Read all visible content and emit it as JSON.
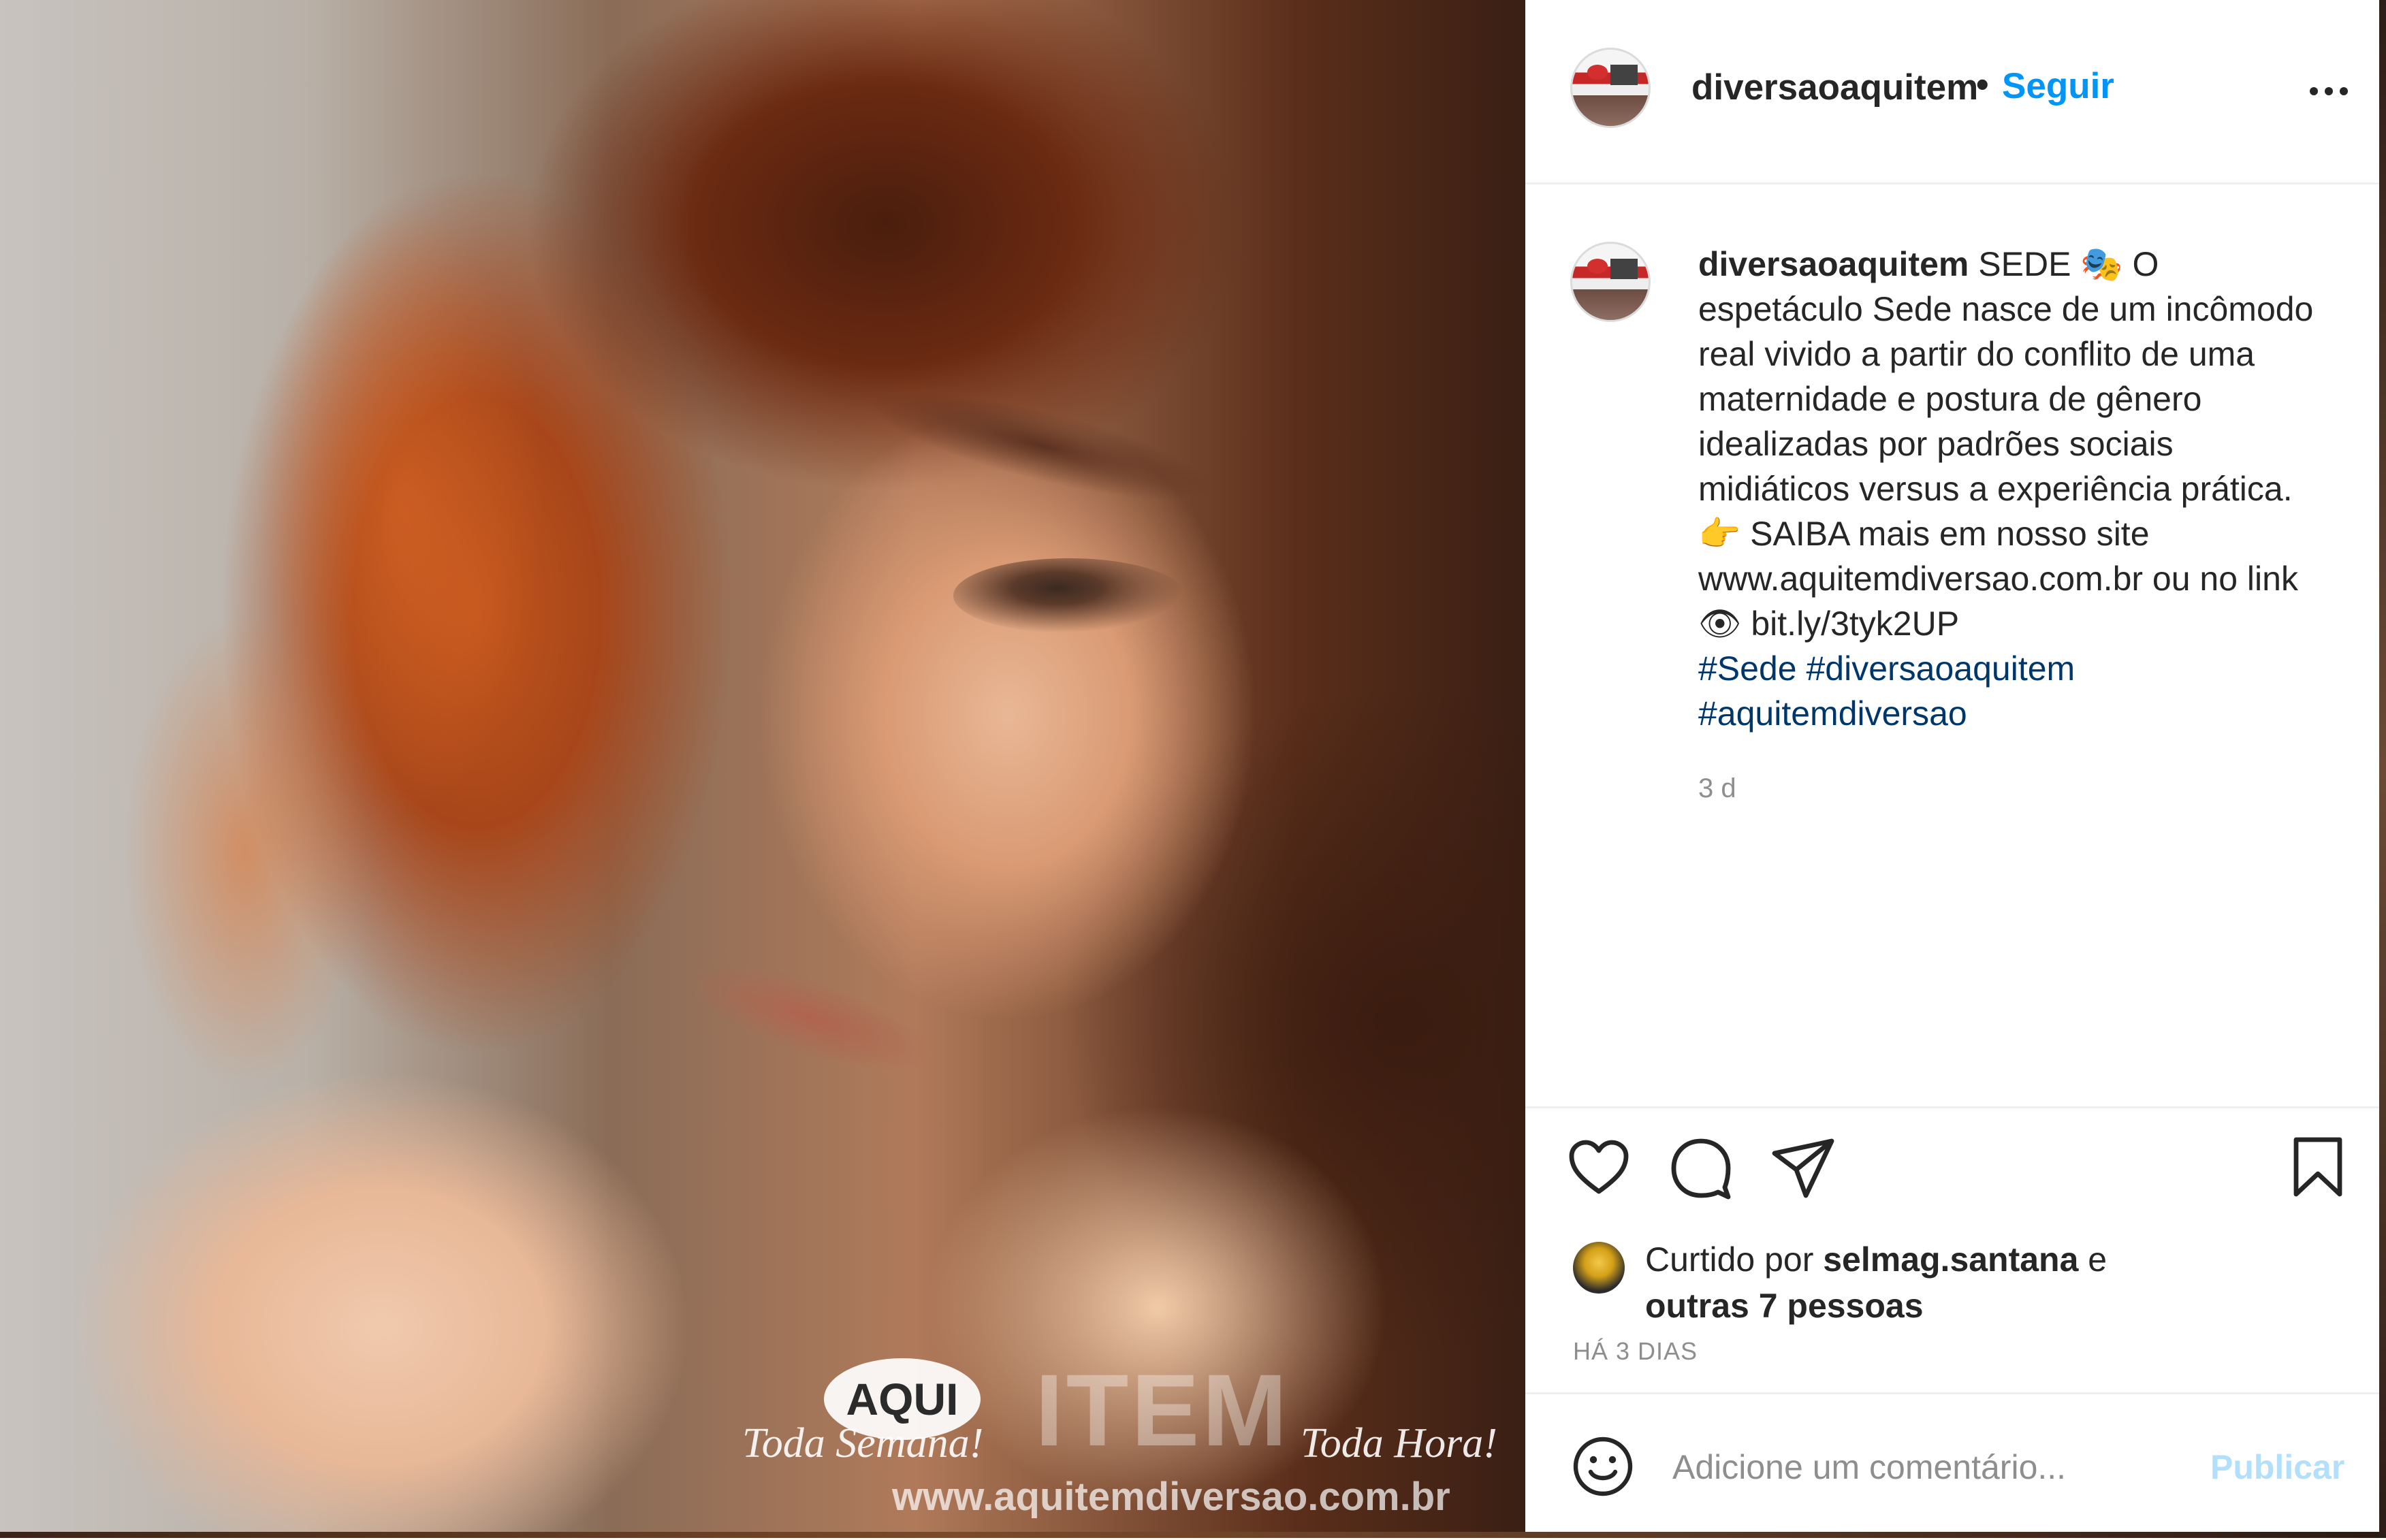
{
  "post": {
    "username": "diversaoaquitem",
    "follow_label": "Seguir",
    "separator": "•"
  },
  "caption": {
    "username": "diversaoaquitem",
    "part1": " SEDE ",
    "emoji1": "🎭",
    "part2": " O espetáculo Sede nasce de um incômodo real vivido a partir do conflito de uma maternidade e postura de gênero idealizadas por padrões sociais midiáticos versus a experiência prática. ",
    "emoji2": "👉",
    "part3": " SAIBA mais em nosso site www.aquitemdiversao.com.br ou no link ",
    "emoji3": "👁",
    "part4": " bit.ly/3tyk2UP",
    "hashtags": [
      "#Sede",
      "#diversaoaquitem",
      "#aquitemdiversao"
    ],
    "time": "3 d"
  },
  "likes": {
    "prefix": "Curtido por ",
    "liker": "selmag.santana",
    "middle": " e",
    "others": "outras 7 pessoas"
  },
  "date_label": "HÁ 3 DIAS",
  "comment": {
    "placeholder": "Adicione um comentário...",
    "publish_label": "Publicar"
  },
  "image_watermark": {
    "logo_text": "AQUI",
    "left_script": "Toda Semana!",
    "right_script": "Toda Hora!",
    "big_text": "ITEM",
    "url_text": "www.aquitemdiversao.com.br"
  },
  "icons": {
    "like": "heart-icon",
    "comment": "comment-bubble-icon",
    "share": "paper-plane-icon",
    "save": "bookmark-icon",
    "emoji": "smiley-icon",
    "more": "more-options-icon"
  },
  "colors": {
    "accent": "#0095f6",
    "publish_disabled": "#b2dffc",
    "hashtag": "#00376b",
    "text": "#262626",
    "muted": "#8e8e8e"
  }
}
